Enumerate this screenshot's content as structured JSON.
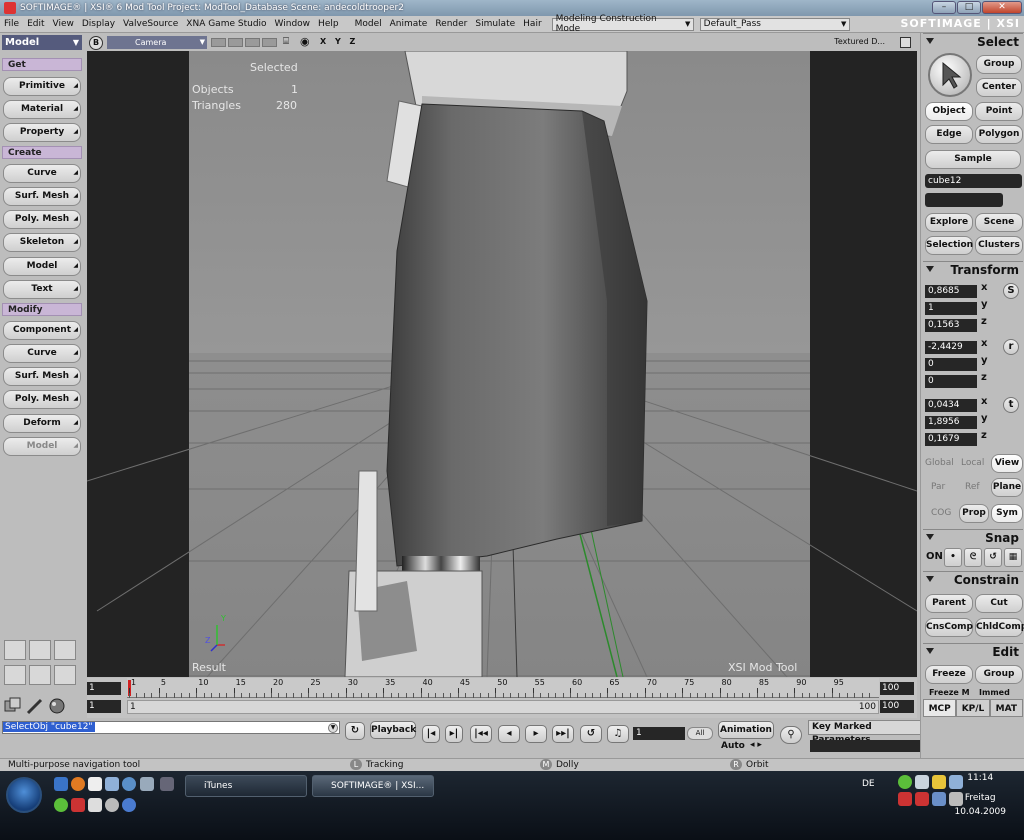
{
  "titlebar": {
    "title": "SOFTIMAGE® | XSI® 6 Mod Tool Project: ModTool_Database    Scene: andecoldtrooper2"
  },
  "menubar": {
    "items": [
      "File",
      "Edit",
      "View",
      "Display",
      "ValveSource",
      "XNA Game Studio",
      "Window",
      "Help",
      "Model",
      "Animate",
      "Render",
      "Simulate",
      "Hair"
    ],
    "construction_mode": "Modeling Construction Mode",
    "pass": "Default_Pass",
    "brand": "SOFTIMAGE | XSI"
  },
  "left_panel": {
    "mode": "Model",
    "sections": {
      "get": "Get",
      "create": "Create",
      "modify": "Modify"
    },
    "get_buttons": [
      "Primitive",
      "Material",
      "Property"
    ],
    "create_buttons": [
      "Curve",
      "Surf. Mesh",
      "Poly. Mesh",
      "Skeleton",
      "Model",
      "Text"
    ],
    "modify_buttons": [
      "Component",
      "Curve",
      "Surf. Mesh",
      "Poly. Mesh",
      "Deform",
      "Model"
    ]
  },
  "viewport": {
    "header_b": "B",
    "camera": "Camera",
    "axes": "X Y Z",
    "shading": "Textured D...",
    "selected_label": "Selected",
    "objects_label": "Objects",
    "objects_value": "1",
    "triangles_label": "Triangles",
    "triangles_value": "280",
    "result_label": "Result",
    "watermark": "XSI Mod Tool",
    "axis_y": "Y",
    "axis_z": "Z"
  },
  "timeline": {
    "start_top": "1",
    "start_bottom": "1",
    "end_top": "100",
    "end_bottom": "100",
    "end_mid": "100",
    "current": "1",
    "ticks": [
      "1",
      "5",
      "10",
      "15",
      "20",
      "25",
      "30",
      "35",
      "40",
      "45",
      "50",
      "55",
      "60",
      "65",
      "70",
      "75",
      "80",
      "85",
      "90",
      "95"
    ]
  },
  "command": {
    "text": "SelectObj \"cube12\"",
    "playback": "Playback",
    "frame": "1",
    "all": "All",
    "animation": "Animation",
    "auto": "Auto",
    "key_marked": "Key Marked Parameters"
  },
  "status": {
    "hint": "Multi-purpose navigation tool",
    "l_key": "L",
    "l_label": "Tracking",
    "m_key": "M",
    "m_label": "Dolly",
    "r_key": "R",
    "r_label": "Orbit"
  },
  "right_panel": {
    "select_header": "Select",
    "group": "Group",
    "center": "Center",
    "object": "Object",
    "point": "Point",
    "edge": "Edge",
    "polygon": "Polygon",
    "sample": "Sample",
    "selection_name": "cube12",
    "explore": "Explore",
    "scene": "Scene",
    "selection": "Selection",
    "clusters": "Clusters",
    "transform_header": "Transform",
    "scale": [
      "0,8685",
      "1",
      "0,1563"
    ],
    "rotation": [
      "-2,4429",
      "0",
      "0"
    ],
    "translation": [
      "0,0434",
      "1,8956",
      "0,1679"
    ],
    "axis_labels": [
      "x",
      "y",
      "z"
    ],
    "s_btn": "S",
    "r_btn": "r",
    "t_btn": "t",
    "global": "Global",
    "local": "Local",
    "view": "View",
    "par": "Par",
    "ref": "Ref",
    "plane": "Plane",
    "cog": "COG",
    "prop": "Prop",
    "sym": "Sym",
    "snap_header": "Snap",
    "snap_on": "ON",
    "constrain_header": "Constrain",
    "parent": "Parent",
    "cut": "Cut",
    "cnscomp": "CnsComp",
    "chldcomp": "ChldComp",
    "edit_header": "Edit",
    "freeze": "Freeze",
    "group2": "Group",
    "freeze_m": "Freeze M",
    "immed": "Immed",
    "tabs": [
      "MCP",
      "KP/L",
      "MAT"
    ]
  },
  "taskbar": {
    "itunes": "iTunes",
    "softimage": "SOFTIMAGE® | XSI...",
    "lang": "DE",
    "time": "11:14",
    "day": "Freitag",
    "date": "10.04.2009"
  }
}
